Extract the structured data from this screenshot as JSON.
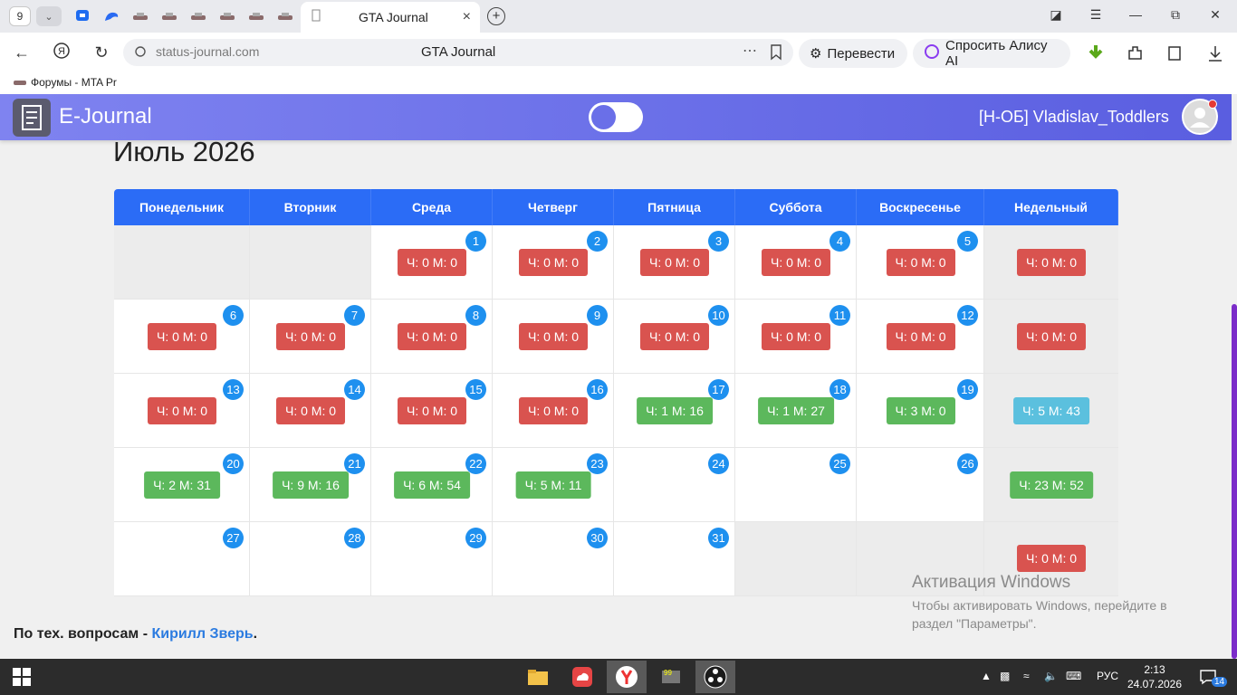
{
  "browser": {
    "tab_count": "9",
    "active_tab_title": "GTA Journal",
    "url": "status-journal.com",
    "page_title": "GTA Journal",
    "translate_label": "Перевести",
    "alice_label": "Спросить Алису AI",
    "bookmark_label": "Форумы - MTA Pr"
  },
  "app": {
    "brand": "E-Journal",
    "username": "[Н-ОБ] Vladislav_Toddlers",
    "month_title": "Июль 2026",
    "weekday_headers": [
      "Понедельник",
      "Вторник",
      "Среда",
      "Четверг",
      "Пятница",
      "Суббота",
      "Воскресенье",
      "Недельный"
    ],
    "weeks": [
      {
        "days": [
          null,
          null,
          {
            "n": "1",
            "v": "Ч: 0 М: 0",
            "c": "red"
          },
          {
            "n": "2",
            "v": "Ч: 0 М: 0",
            "c": "red"
          },
          {
            "n": "3",
            "v": "Ч: 0 М: 0",
            "c": "red"
          },
          {
            "n": "4",
            "v": "Ч: 0 М: 0",
            "c": "red"
          },
          {
            "n": "5",
            "v": "Ч: 0 М: 0",
            "c": "red"
          }
        ],
        "total": {
          "v": "Ч: 0 М: 0",
          "c": "red"
        }
      },
      {
        "days": [
          {
            "n": "6",
            "v": "Ч: 0 М: 0",
            "c": "red"
          },
          {
            "n": "7",
            "v": "Ч: 0 М: 0",
            "c": "red"
          },
          {
            "n": "8",
            "v": "Ч: 0 М: 0",
            "c": "red"
          },
          {
            "n": "9",
            "v": "Ч: 0 М: 0",
            "c": "red"
          },
          {
            "n": "10",
            "v": "Ч: 0 М: 0",
            "c": "red"
          },
          {
            "n": "11",
            "v": "Ч: 0 М: 0",
            "c": "red"
          },
          {
            "n": "12",
            "v": "Ч: 0 М: 0",
            "c": "red"
          }
        ],
        "total": {
          "v": "Ч: 0 М: 0",
          "c": "red"
        }
      },
      {
        "days": [
          {
            "n": "13",
            "v": "Ч: 0 М: 0",
            "c": "red"
          },
          {
            "n": "14",
            "v": "Ч: 0 М: 0",
            "c": "red"
          },
          {
            "n": "15",
            "v": "Ч: 0 М: 0",
            "c": "red"
          },
          {
            "n": "16",
            "v": "Ч: 0 М: 0",
            "c": "red"
          },
          {
            "n": "17",
            "v": "Ч: 1 М: 16",
            "c": "green"
          },
          {
            "n": "18",
            "v": "Ч: 1 М: 27",
            "c": "green"
          },
          {
            "n": "19",
            "v": "Ч: 3 М: 0",
            "c": "green"
          }
        ],
        "total": {
          "v": "Ч: 5 М: 43",
          "c": "blue"
        }
      },
      {
        "days": [
          {
            "n": "20",
            "v": "Ч: 2 М: 31",
            "c": "green"
          },
          {
            "n": "21",
            "v": "Ч: 9 М: 16",
            "c": "green"
          },
          {
            "n": "22",
            "v": "Ч: 6 М: 54",
            "c": "green"
          },
          {
            "n": "23",
            "v": "Ч: 5 М: 11",
            "c": "green"
          },
          {
            "n": "24",
            "v": "",
            "c": ""
          },
          {
            "n": "25",
            "v": "",
            "c": ""
          },
          {
            "n": "26",
            "v": "",
            "c": ""
          }
        ],
        "total": {
          "v": "Ч: 23 М: 52",
          "c": "green"
        }
      },
      {
        "days": [
          {
            "n": "27",
            "v": "",
            "c": ""
          },
          {
            "n": "28",
            "v": "",
            "c": ""
          },
          {
            "n": "29",
            "v": "",
            "c": ""
          },
          {
            "n": "30",
            "v": "",
            "c": ""
          },
          {
            "n": "31",
            "v": "",
            "c": ""
          },
          null,
          null
        ],
        "total": {
          "v": "Ч: 0 М: 0",
          "c": "red"
        }
      }
    ],
    "footer_prefix": "По тех. вопросам - ",
    "footer_link": "Кирилл Зверь",
    "footer_suffix": "."
  },
  "watermark": {
    "title": "Активация Windows",
    "text": "Чтобы активировать Windows, перейдите в раздел \"Параметры\"."
  },
  "taskbar": {
    "lang": "РУС",
    "time": "2:13",
    "date": "24.07.2026",
    "notifications": "14"
  },
  "colors": {
    "red": "#d9534f",
    "green": "#5cb85c",
    "blue": "#5bc0de",
    "header": "#2b6cf6",
    "day_circle": "#1e90ef"
  }
}
